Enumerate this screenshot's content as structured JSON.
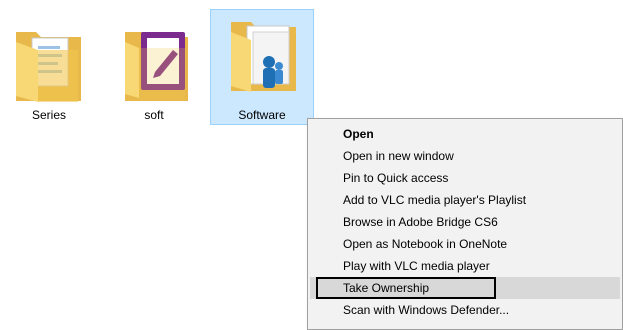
{
  "folders": [
    {
      "name": "Series",
      "icon": "folder-with-documents-icon",
      "selected": false
    },
    {
      "name": "soft",
      "icon": "folder-with-onenote-icon",
      "selected": false
    },
    {
      "name": "Software",
      "icon": "folder-with-setup-icon",
      "selected": true
    }
  ],
  "context_menu": {
    "items": [
      {
        "label": "Open",
        "bold": true
      },
      {
        "label": "Open in new window"
      },
      {
        "label": "Pin to Quick access"
      },
      {
        "label": "Add to VLC media player's Playlist"
      },
      {
        "label": "Browse in Adobe Bridge CS6"
      },
      {
        "label": "Open as Notebook in OneNote"
      },
      {
        "label": "Play with VLC media player"
      },
      {
        "label": "Take Ownership",
        "highlighted": true
      },
      {
        "label": "Scan with Windows Defender..."
      }
    ]
  },
  "colors": {
    "selection_fill": "#cce8ff",
    "selection_border": "#99d1ff",
    "menu_bg": "#f2f2f2",
    "hover": "#d8d8d8",
    "folder_yellow": "#f8d775"
  }
}
